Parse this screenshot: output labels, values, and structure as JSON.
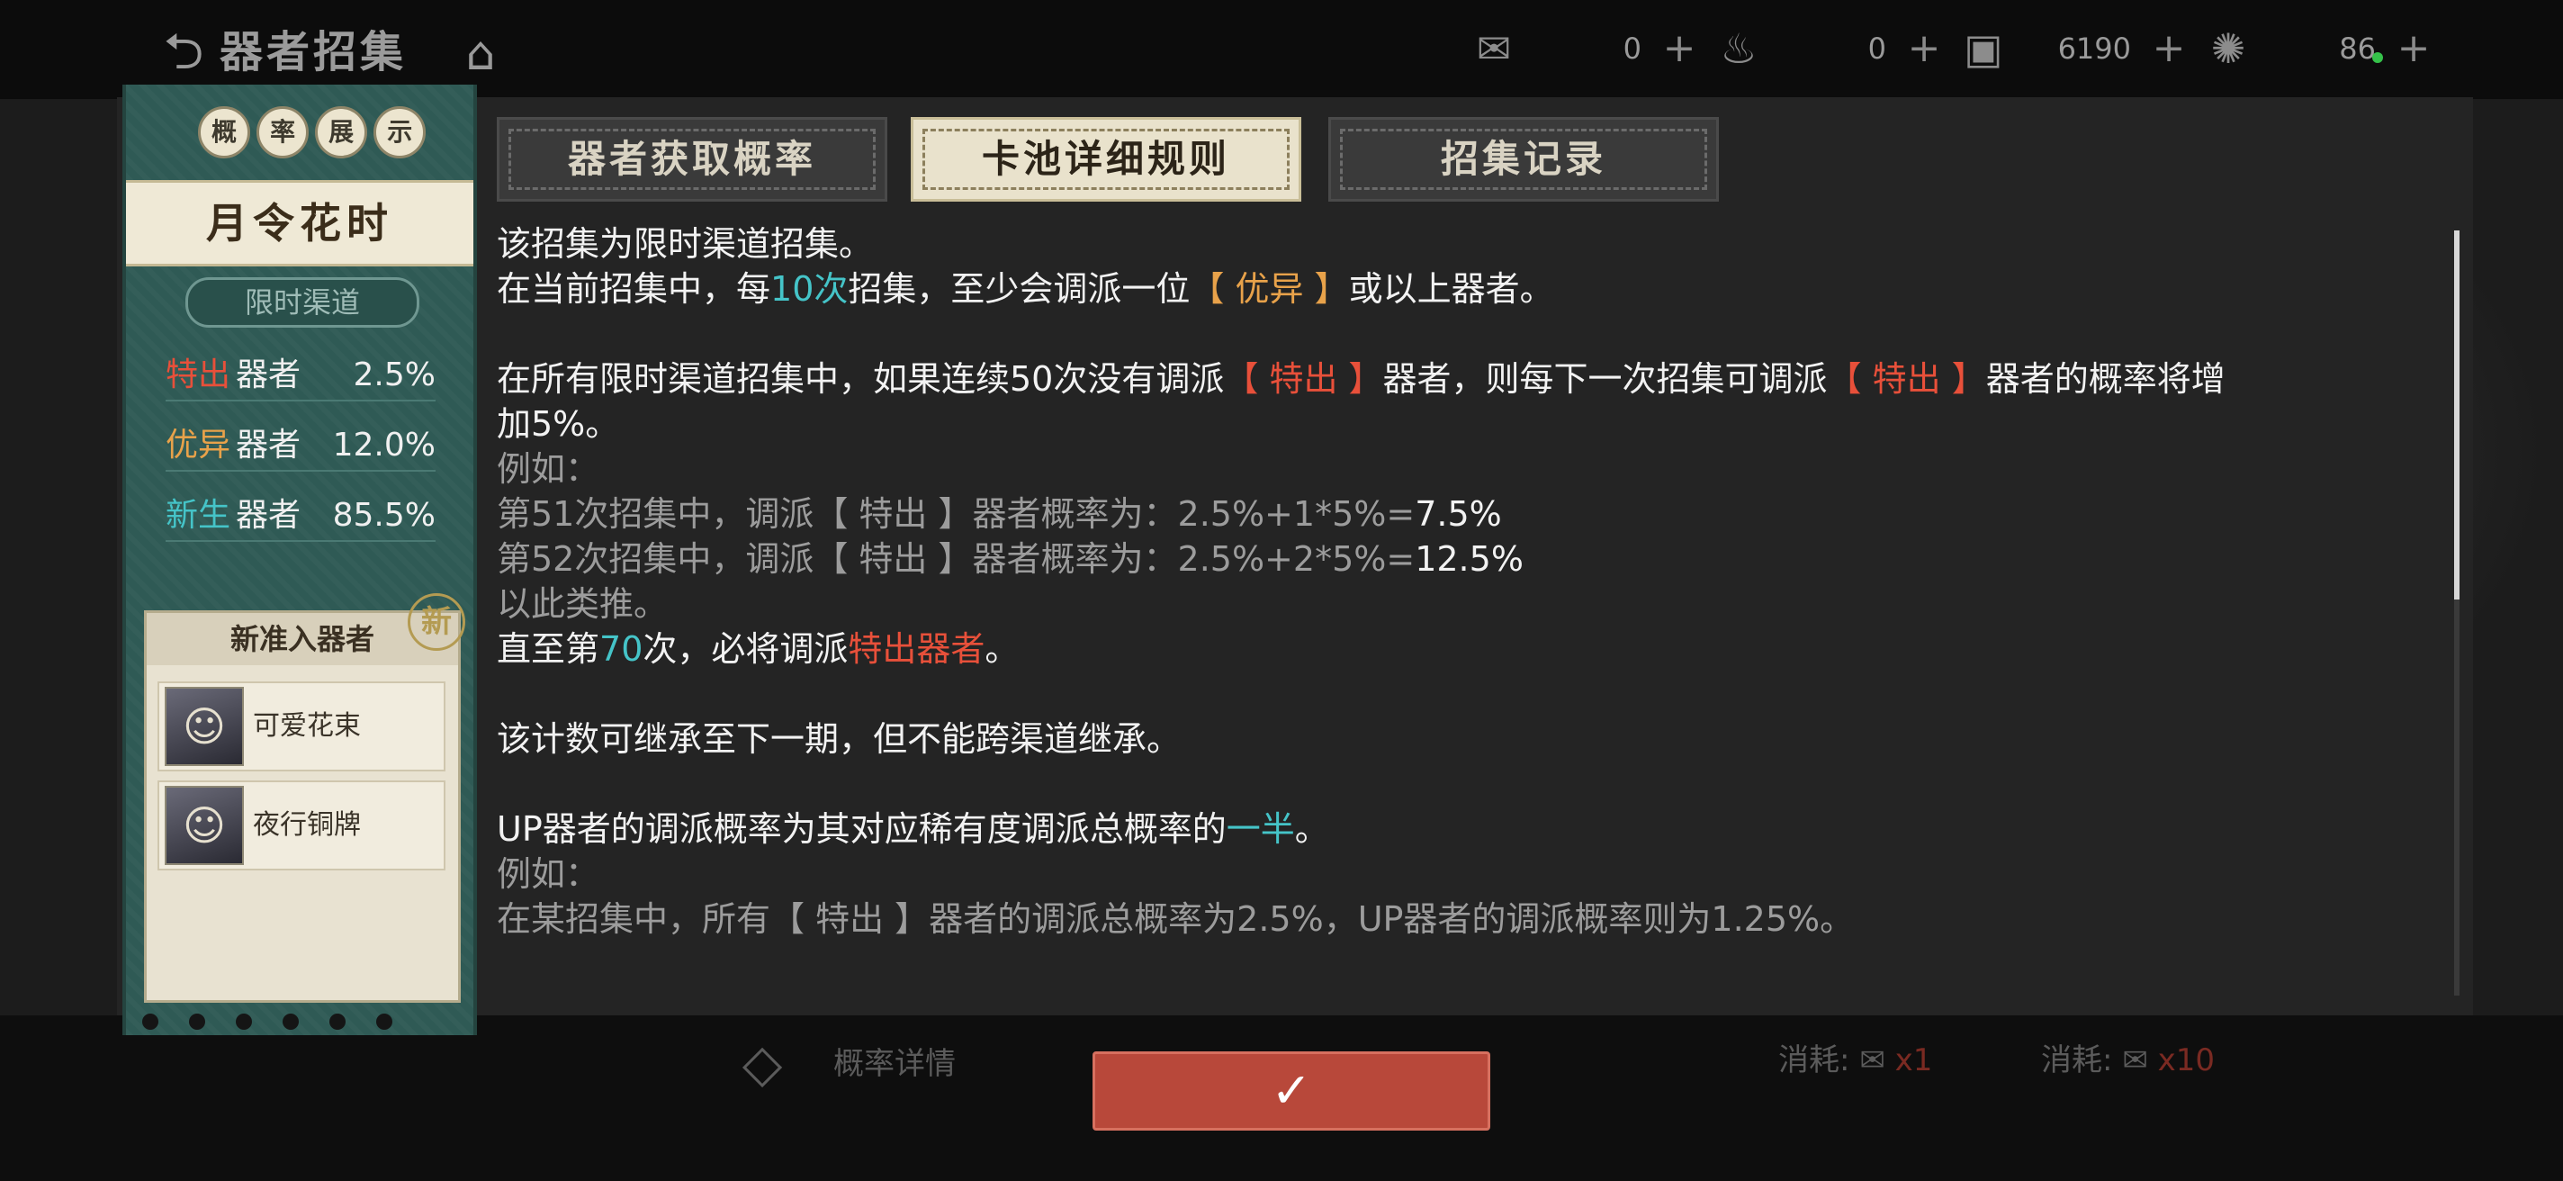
{
  "header": {
    "back_icon": "back-arrow-icon",
    "title": "器者招集",
    "home_icon": "home-icon",
    "currencies": [
      {
        "icon": "envelope-icon",
        "value": "0"
      },
      {
        "icon": "bell-icon",
        "value": "0"
      },
      {
        "icon": "coin-icon",
        "value": "6190"
      },
      {
        "icon": "gem-icon",
        "value": "86"
      }
    ],
    "plus": "+"
  },
  "sidebar": {
    "rate_badges": [
      "概",
      "率",
      "展",
      "示"
    ],
    "pool_name": "月令花时",
    "channel_tag": "限时渠道",
    "rates": [
      {
        "rarity": "特出",
        "kind": "器者",
        "value": "2.5%",
        "color": "#e8503a"
      },
      {
        "rarity": "优异",
        "kind": "器者",
        "value": "12.0%",
        "color": "#e8a24a"
      },
      {
        "rarity": "新生",
        "kind": "器者",
        "value": "85.5%",
        "color": "#45c4c8"
      }
    ],
    "new_title": "新准入器者",
    "new_seal": "新",
    "new_items": [
      {
        "name": "可爱花束"
      },
      {
        "name": "夜行铜牌"
      }
    ]
  },
  "tabs": [
    {
      "label": "器者获取概率",
      "active": false
    },
    {
      "label": "卡池详细规则",
      "active": true
    },
    {
      "label": "招集记录",
      "active": false
    }
  ],
  "rules": {
    "l1": "该招集为限时渠道招集。",
    "l2": {
      "a": "在当前招集中，每",
      "b": "10次",
      "c": "招集，至少会调派一位",
      "d": "【 优异 】",
      "e": "或以上器者。"
    },
    "l3": {
      "a": "在所有限时渠道招集中，如果连续50次没有调派",
      "b": "【 特出 】",
      "c": "器者，则每下一次招集可调派",
      "d": "【 特出 】",
      "e": "器者的概率将增"
    },
    "l4": "加5%。",
    "l5": "例如：",
    "l6": {
      "a": "第51次招集中，调派【 特出 】器者概率为：2.5%+1*5%=",
      "b": "7.5%"
    },
    "l7": {
      "a": "第52次招集中，调派【 特出 】器者概率为：2.5%+2*5%=",
      "b": "12.5%"
    },
    "l8": "以此类推。",
    "l9": {
      "a": "直至第",
      "b": "70",
      "c": "次，必将调派",
      "d": "特出器者",
      "e": "。"
    },
    "l10": "该计数可继承至下一期，但不能跨渠道继承。",
    "l11": {
      "a": "UP器者的调派概率为其对应稀有度调派总概率的",
      "b": "一半",
      "c": "。"
    },
    "l12": "例如：",
    "l13": "在某招集中，所有【 特出 】器者的调派总概率为2.5%，UP器者的调派概率则为1.25%。"
  },
  "background": {
    "prob_detail_label": "概率详情",
    "cost_label_1": "消耗:",
    "cost_amount_1": "x1",
    "cost_label_2": "消耗:",
    "cost_amount_2": "x10"
  },
  "confirm": {
    "icon": "checkmark-icon",
    "glyph": "✓"
  }
}
